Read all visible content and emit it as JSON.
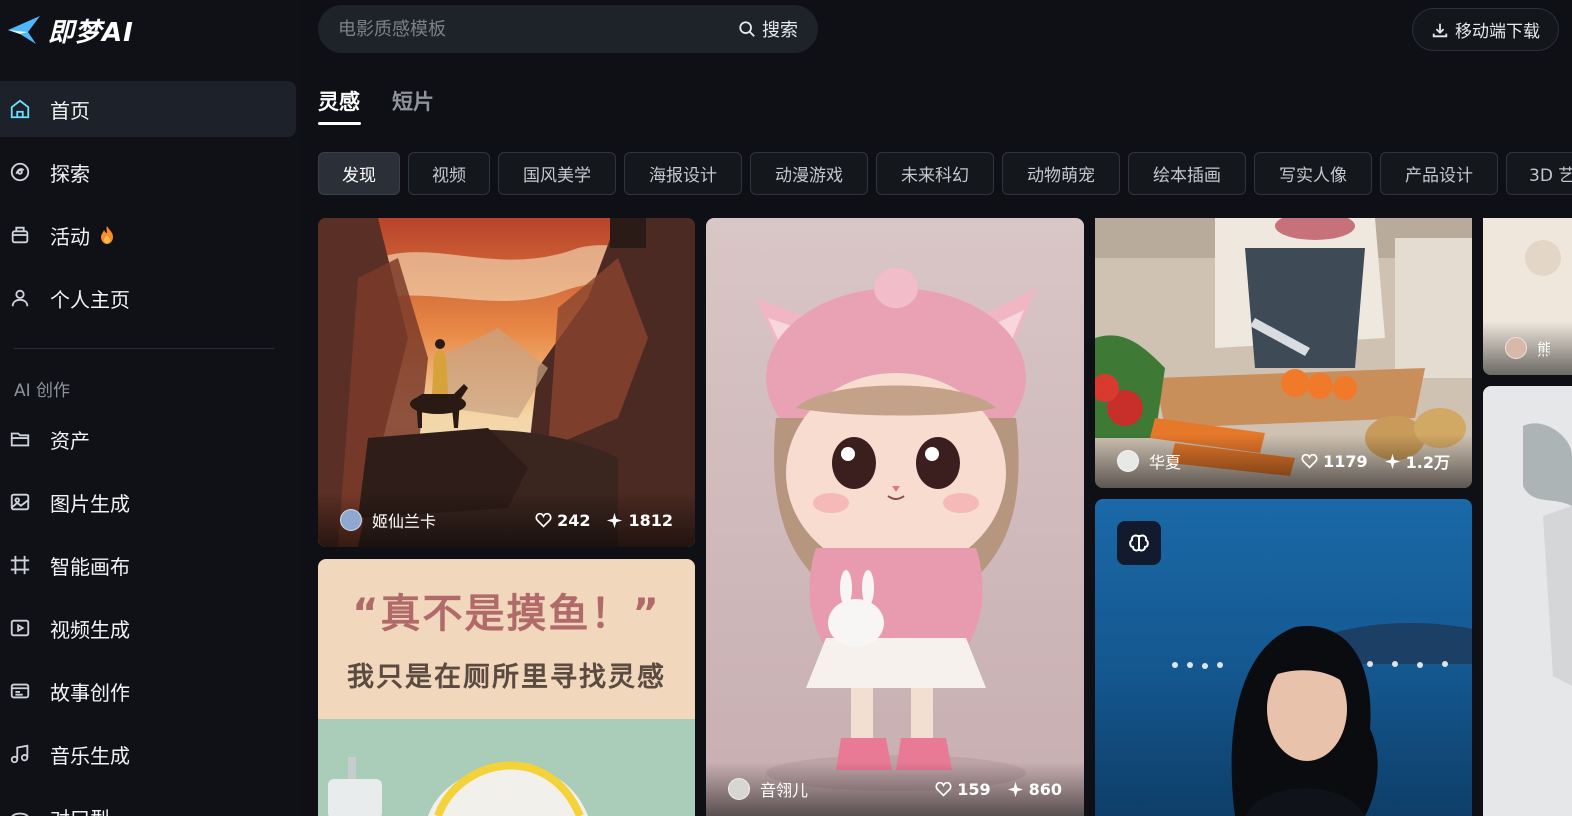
{
  "app": {
    "name": "即梦AI"
  },
  "header": {
    "search_placeholder": "电影质感模板",
    "search_button": "搜索",
    "download_button": "移动端下载"
  },
  "sidebar": {
    "items": [
      {
        "label": "首页",
        "icon": "home-icon",
        "active": true
      },
      {
        "label": "探索",
        "icon": "explore-icon"
      },
      {
        "label": "活动",
        "icon": "activity-icon",
        "badge": "fire-icon"
      },
      {
        "label": "个人主页",
        "icon": "user-icon"
      }
    ],
    "section_title": "AI 创作",
    "create_items": [
      {
        "label": "资产",
        "icon": "folder-icon"
      },
      {
        "label": "图片生成",
        "icon": "image-gen-icon"
      },
      {
        "label": "智能画布",
        "icon": "canvas-icon"
      },
      {
        "label": "视频生成",
        "icon": "video-gen-icon"
      },
      {
        "label": "故事创作",
        "icon": "story-icon"
      },
      {
        "label": "音乐生成",
        "icon": "music-icon"
      },
      {
        "label": "对口型",
        "icon": "lipsync-icon"
      }
    ]
  },
  "tabs": [
    {
      "label": "灵感",
      "active": true
    },
    {
      "label": "短片",
      "active": false
    }
  ],
  "chips": [
    "发现",
    "视频",
    "国风美学",
    "海报设计",
    "动漫游戏",
    "未来科幻",
    "动物萌宠",
    "绘本插画",
    "写实人像",
    "产品设计",
    "3D 艺"
  ],
  "cards": {
    "card1": {
      "author": "姬仙兰卡",
      "likes": "242",
      "uses": "1812"
    },
    "card2": {
      "poster_line1": "“真不是摸鱼！”",
      "poster_line2": "我只是在厕所里寻找灵感"
    },
    "card3": {
      "author": "音翎儿",
      "likes": "159",
      "uses": "860"
    },
    "card4": {
      "author": "华夏",
      "likes": "1179",
      "uses": "1.2万"
    },
    "card6": {
      "author": "熊猫"
    }
  },
  "colors": {
    "background": "#0e1015",
    "sidebar_active": "#1d2129",
    "accent_fire": "#ff8a2a",
    "logo_blue": "#4fb7ff"
  }
}
